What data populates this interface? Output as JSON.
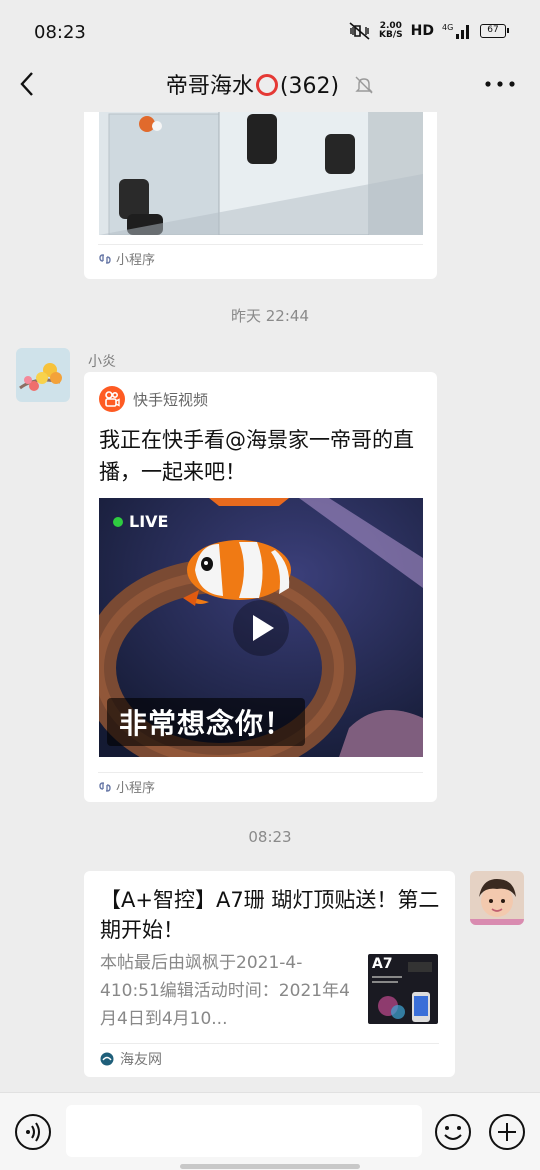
{
  "status_bar": {
    "time": "08:23",
    "speed_value": "2.00",
    "speed_unit": "KB/S",
    "network": "HD",
    "signal": "4G",
    "battery": "67"
  },
  "nav": {
    "title_prefix": "帝哥海水",
    "title_suffix": "(362)"
  },
  "messages": {
    "first_card_footer": "小程序",
    "ts1": "昨天 22:44",
    "sender_name": "小炎",
    "ks_app_name": "快手短视频",
    "ks_text": "我正在快手看@海景家一帝哥的直播，一起来吧！",
    "ks_live": "LIVE",
    "ks_caption": "非常想念你！",
    "ks_footer": "小程序",
    "ts2": "08:23",
    "link_title": "【A+智控】A7珊 瑚灯顶贴送！第二期开始！",
    "link_desc": "本帖最后由飒枫于2021-4-410:51编辑活动时间：2021年4月4日到4月10...",
    "link_thumb_label": "A7",
    "link_source": "海友网"
  },
  "colors": {
    "accent_orange": "#fe5b23",
    "ring_red": "#e53935",
    "background": "#ededed"
  }
}
